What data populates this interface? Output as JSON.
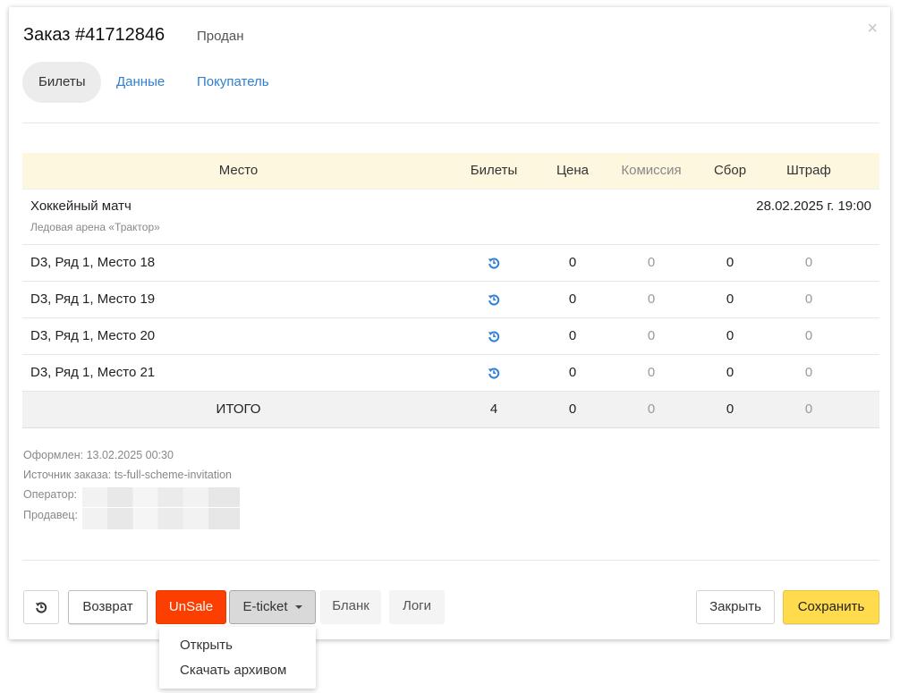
{
  "modal": {
    "title": "Заказ #41712846",
    "status": "Продан",
    "close_symbol": "×"
  },
  "tabs": [
    {
      "label": "Билеты",
      "active": true
    },
    {
      "label": "Данные",
      "active": false
    },
    {
      "label": "Покупатель",
      "active": false
    }
  ],
  "table": {
    "headers": {
      "place": "Место",
      "tickets": "Билеты",
      "price": "Цена",
      "commission": "Комиссия",
      "fee": "Сбор",
      "fine": "Штраф"
    },
    "event": {
      "name": "Хоккейный матч",
      "venue": "Ледовая арена «Трактор»",
      "datetime": "28.02.2025 г. 19:00"
    },
    "rows": [
      {
        "place": "D3, Ряд 1, Место 18",
        "tickets_icon": "refund-icon",
        "price": "0",
        "commission": "0",
        "fee": "0",
        "fine": "0"
      },
      {
        "place": "D3, Ряд 1, Место 19",
        "tickets_icon": "refund-icon",
        "price": "0",
        "commission": "0",
        "fee": "0",
        "fine": "0"
      },
      {
        "place": "D3, Ряд 1, Место 20",
        "tickets_icon": "refund-icon",
        "price": "0",
        "commission": "0",
        "fee": "0",
        "fine": "0"
      },
      {
        "place": "D3, Ряд 1, Место 21",
        "tickets_icon": "refund-icon",
        "price": "0",
        "commission": "0",
        "fee": "0",
        "fine": "0"
      }
    ],
    "total": {
      "label": "ИТОГО",
      "tickets": "4",
      "price": "0",
      "commission": "0",
      "fee": "0",
      "fine": "0"
    }
  },
  "info": {
    "created": "Оформлен: 13.02.2025 00:30",
    "source": "Источник заказа: ts-full-scheme-invitation",
    "operator_label": "Оператор:",
    "seller_label": "Продавец:"
  },
  "buttons": {
    "refund_icon": "refund-icon",
    "return": "Возврат",
    "unsale": "UnSale",
    "eticket": "E-ticket",
    "blank": "Бланк",
    "logs": "Логи",
    "close": "Закрыть",
    "save": "Сохранить"
  },
  "dropdown": {
    "items": [
      "Открыть",
      "Скачать архивом"
    ]
  },
  "colors": {
    "accent_link": "#2f7fd3",
    "unsale": "#fc3f00",
    "save": "#ffdb4d",
    "header_bg": "#fef7e0"
  }
}
